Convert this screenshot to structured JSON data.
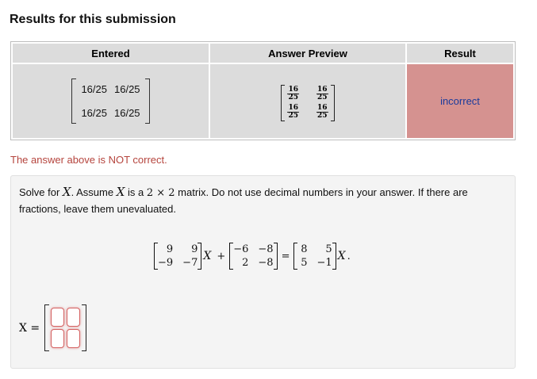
{
  "heading": "Results for this submission",
  "table": {
    "headers": [
      "Entered",
      "Answer Preview",
      "Result"
    ],
    "entered": [
      [
        "16/25",
        "16/25"
      ],
      [
        "16/25",
        "16/25"
      ]
    ],
    "preview": [
      [
        {
          "num": "16",
          "den": "25"
        },
        {
          "num": "16",
          "den": "25"
        }
      ],
      [
        {
          "num": "16",
          "den": "25"
        },
        {
          "num": "16",
          "den": "25"
        }
      ]
    ],
    "result": "incorrect",
    "result_color": "#d59290"
  },
  "feedback": "The answer above is NOT correct.",
  "problem": {
    "part1": "Solve for ",
    "var_x": "X",
    "part2": ". Assume ",
    "var_x2": "X",
    "part3": " is a ",
    "dim": "2 × 2",
    "part4": " matrix. Do not use decimal numbers in your answer. If there are fractions, leave them unevaluated.",
    "equation": {
      "matrix_a": [
        [
          "9",
          "9"
        ],
        [
          "−9",
          "−7"
        ]
      ],
      "matrix_b": [
        [
          "−6",
          "−8"
        ],
        [
          "2",
          "−8"
        ]
      ],
      "matrix_c": [
        [
          "8",
          "5"
        ],
        [
          "5",
          "−1"
        ]
      ],
      "x": "X",
      "plus": "+",
      "equals": "=",
      "period": "."
    },
    "answer_label": "X =",
    "answer_values": [
      [
        "",
        ""
      ],
      [
        "",
        ""
      ]
    ]
  }
}
